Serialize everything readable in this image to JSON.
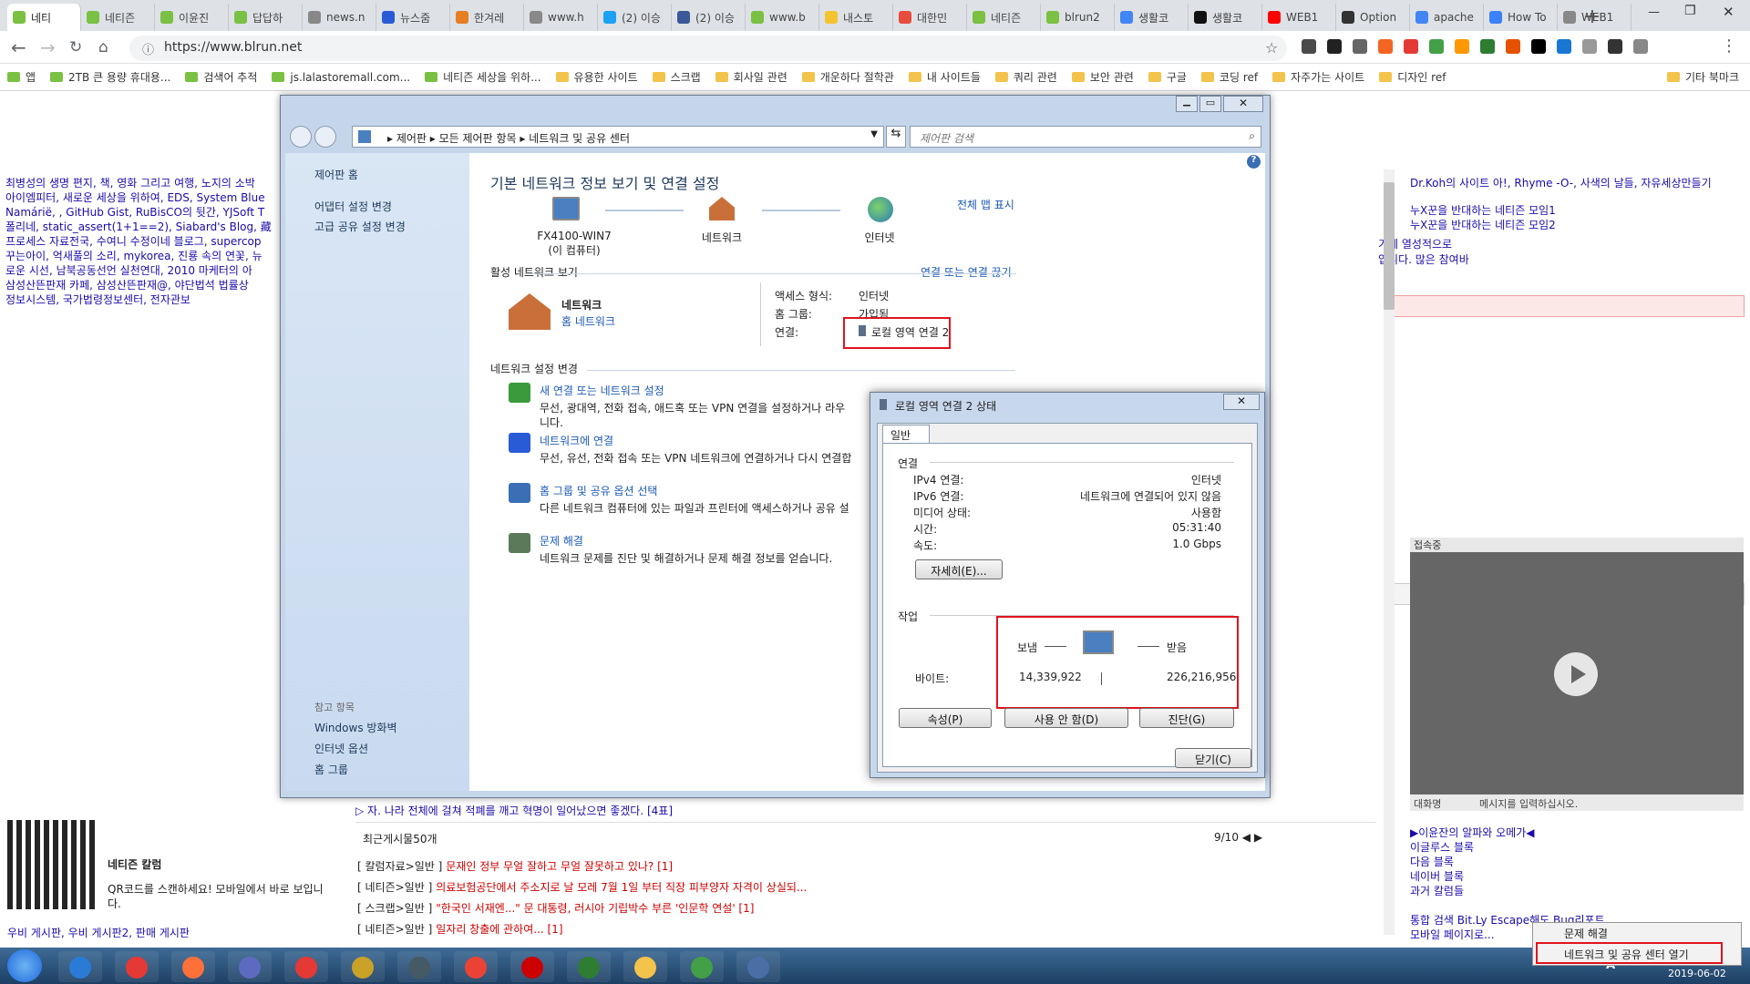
{
  "browser": {
    "tabs": [
      "네티",
      "네티즌",
      "이윤진",
      "답답하",
      "news.n",
      "뉴스줌",
      "한겨레",
      "www.h",
      "(2) 이승",
      "(2) 이승",
      "www.b",
      "내스토",
      "대한민",
      "네티즌",
      "blrun2",
      "생활코",
      "생활코",
      "WEB1",
      "Option",
      "apache",
      "How To",
      "WEB1"
    ],
    "url": "https://www.blrun.net",
    "bookmarks": [
      "앱",
      "2TB 큰 용량 휴대용...",
      "검색어 추적",
      "js.lalastoremall.com...",
      "네티즌 세상을 위하...",
      "유용한 사이트",
      "스크랩",
      "회사일 관련",
      "개운하다 절학관",
      "내 사이트들",
      "쿼리 관련",
      "보안 관련",
      "구글",
      "코딩 ref",
      "자주가는 사이트",
      "디자인 ref"
    ],
    "other_bookmarks": "기타 북마크"
  },
  "page": {
    "left_text": [
      "최병성의 생명 편지, 책, 영화 그리고 여행, 노지의 소박",
      "아이엠피터, 새로운 세상을 위하여, EDS, System Blue",
      "Namárië, , GitHub Gist, RuBisCO의 뒷간, YJSoft T",
      "폴리네, static_assert(1+1==2), Siabard's Blog, 藏",
      "프로세스 자료전국, 수여니 수정이네 블로그, supercop",
      "꾸는아이, 억새풀의 소리, mykorea, 진룡 속의 연꽃, 뉴",
      "로운 시선, 남북공동선언 실천연대, 2010 마케터의 아",
      "삼성산뜬판재 카페, 삼성산뜬판재@, 야단법석 법률상",
      "정보시스템, 국가법령정보센터, 전자관보"
    ],
    "mid_right_text": [
      "기에 열성적으로",
      "입니다. 많은 참여바"
    ],
    "right_text": [
      "Dr.Koh의 사이트 아!, Rhyme -O-, 사색의 날들, 자유세상만들기",
      "누X꾼을 반대하는 네티즌 모임1",
      "누X꾼을 반대하는 네티즌 모임2"
    ],
    "chat_title": "접속중",
    "chat_footer_left": "대화명",
    "chat_footer_right": "메시지를 입력하십시오.",
    "right_links": [
      "▶이윤잔의 알파와 오메가◀",
      "이글루스 블록",
      "다음 블록",
      "네이버 블록",
      "과거 칼럼들"
    ],
    "right_bottom": [
      "통합 검색 Bit.Ly Escape해도 Bug리포트",
      "모바일 페이지로..."
    ],
    "qr_title": "네티즌 칼럼",
    "qr_desc": "QR코드를 스캔하세요! 모바일에서 바로 보입니다.",
    "bottom_links": "우비 게시판, 우비 게시판2, 판매 게시판",
    "list_top": "▷ 자. 나라 전체에 걸쳐 적폐를 깨고 혁명이 일어났으면 좋겠다. [4표]",
    "recent_title": "최근게시물50개",
    "pager": "9/10",
    "posts": [
      {
        "cat": "[ 칼럼자료>일반 ]",
        "title": "문재인 정부 무얼 잘하고 무얼 잘못하고 있나? [1]"
      },
      {
        "cat": "[ 네티즌>일반 ]",
        "title": "의료보험공단에서 주소지로 날 모레 7월 1일 부터 직장 피부양자 자격이 상실되..."
      },
      {
        "cat": "[ 스크랩>일반 ]",
        "title": "\"한국인 서재엔...\" 문 대통령, 러시아 기립박수 부른 '인문학 연설' [1]"
      },
      {
        "cat": "[ 네티즌>일반 ]",
        "title": "일자리 창출에 관하여... [1]"
      }
    ]
  },
  "control_panel": {
    "address": [
      "제어판",
      "모든 제어판 항목",
      "네트워크 및 공유 센터"
    ],
    "search_placeholder": "제어판 검색",
    "side": {
      "home": "제어판 홈",
      "links": [
        "어댑터 설정 변경",
        "고급 공유 설정 변경"
      ],
      "see_also": "참고 항목",
      "see_links": [
        "Windows 방화벽",
        "인터넷 옵션",
        "홈 그룹"
      ]
    },
    "title": "기본 네트워크 정보 보기 및 연결 설정",
    "full_map": "전체 맵 표시",
    "map": {
      "computer": "FX4100-WIN7",
      "computer_sub": "(이 컴퓨터)",
      "network": "네트워크",
      "internet": "인터넷"
    },
    "active_title": "활성 네트워크 보기",
    "connect_link": "연결 또는 연결 끊기",
    "net_name": "네트워크",
    "net_type": "홈 네트워크",
    "access_label": "액세스 형식:",
    "access_value": "인터넷",
    "homegroup_label": "홈 그룹:",
    "homegroup_value": "가입됨",
    "conn_label": "연결:",
    "conn_value": "로컬 영역 연결 2",
    "change_title": "네트워크 설정 변경",
    "tasks": [
      {
        "link": "새 연결 또는 네트워크 설정",
        "desc": "무선, 광대역, 전화 접속, 애드혹 또는 VPN 연결을 설정하거나 라우",
        "desc2": "니다."
      },
      {
        "link": "네트워크에 연결",
        "desc": "무선, 유선, 전화 접속 또는 VPN 네트워크에 연결하거나 다시 연결합",
        "desc2": ""
      },
      {
        "link": "홈 그룹 및 공유 옵션 선택",
        "desc": "다른 네트워크 컴퓨터에 있는 파일과 프린터에 액세스하거나 공유 설",
        "desc2": ""
      },
      {
        "link": "문제 해결",
        "desc": "네트워크 문제를 진단 및 해결하거나 문제 해결 정보를 얻습니다.",
        "desc2": ""
      }
    ]
  },
  "status_dialog": {
    "title": "로컬 영역 연결 2 상태",
    "tab": "일반",
    "conn_group": "연결",
    "rows": [
      {
        "label": "IPv4 연결:",
        "value": "인터넷"
      },
      {
        "label": "IPv6 연결:",
        "value": "네트워크에 연결되어 있지 않음"
      },
      {
        "label": "미디어 상태:",
        "value": "사용함"
      },
      {
        "label": "시간:",
        "value": "05:31:40"
      },
      {
        "label": "속도:",
        "value": "1.0 Gbps"
      }
    ],
    "details_btn": "자세히(E)...",
    "activity_group": "작업",
    "sent_label": "보냄",
    "recv_label": "받음",
    "bytes_label": "바이트:",
    "sent_value": "14,339,922",
    "recv_value": "226,216,956",
    "props_btn": "속성(P)",
    "disable_btn": "사용 안 함(D)",
    "diag_btn": "진단(G)",
    "close_btn": "닫기(C)"
  },
  "context_menu": {
    "items": [
      "문제 해결",
      "네트워크 및 공유 센터 열기"
    ]
  },
  "taskbar": {
    "lang": "A",
    "date": "2019-06-02"
  },
  "colors": {
    "accent_red": "#e0141e",
    "link": "#1c5ab5"
  }
}
